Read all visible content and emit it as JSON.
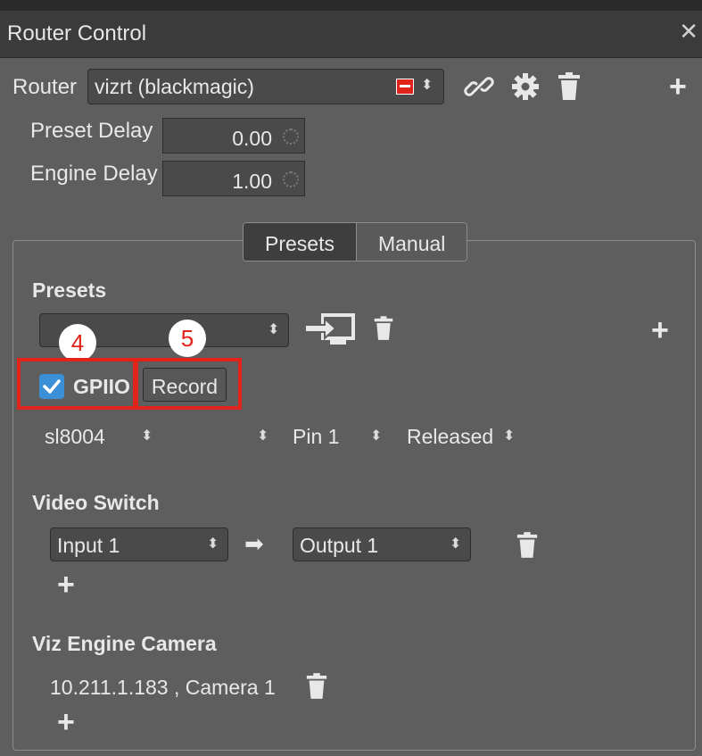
{
  "window": {
    "title": "Router Control",
    "close_glyph": "✕"
  },
  "router": {
    "label": "Router",
    "selected": "vizrt  (blackmagic)",
    "icons": [
      "link-icon",
      "gear-icon",
      "trash-icon",
      "plus-icon"
    ]
  },
  "delays": {
    "preset_label": "Preset Delay",
    "preset_value": "0.00",
    "engine_label": "Engine Delay",
    "engine_value": "1.00"
  },
  "tabs": [
    {
      "label": "Presets",
      "active": true
    },
    {
      "label": "Manual",
      "active": false
    }
  ],
  "presets": {
    "heading": "Presets",
    "selected": "",
    "gpio_label": "GPIIO",
    "gpio_checked": true,
    "record_label": "Record",
    "gpi_row": {
      "device": "sl8004",
      "second": "",
      "pin": "Pin 1",
      "state": "Released"
    }
  },
  "annotations": {
    "badge_a": "4",
    "badge_b": "5"
  },
  "video_switch": {
    "heading": "Video Switch",
    "input": "Input 1",
    "output": "Output 1",
    "arrow": "➡"
  },
  "camera": {
    "heading": "Viz Engine Camera",
    "entry": "10.211.1.183 , Camera 1"
  },
  "glyphs": {
    "plus": "+",
    "updown": "⬍"
  },
  "colors": {
    "accent_red": "#e2231a",
    "checkbox_blue": "#3a8fd6",
    "panel_bg": "#5e5e5e",
    "title_bg": "#3b3b3b"
  }
}
